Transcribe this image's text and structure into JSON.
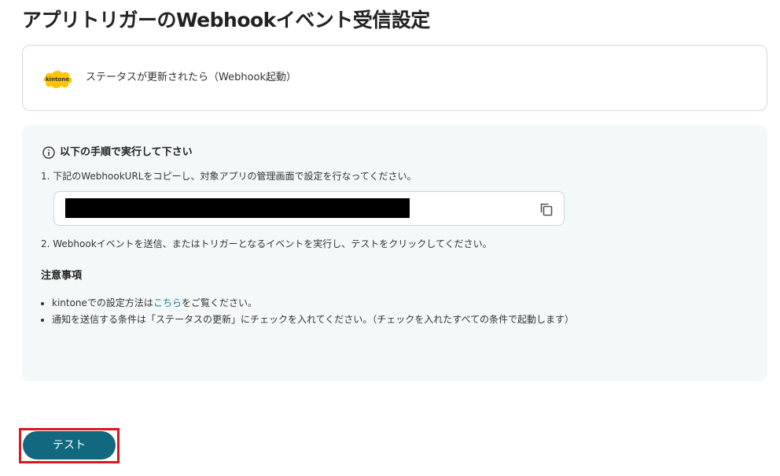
{
  "page": {
    "title": "アプリトリガーのWebhookイベント受信設定"
  },
  "trigger": {
    "app_logo_text": "kintone",
    "app_logo_icon": "kintone-logo-icon",
    "label": "ステータスが更新されたら（Webhook起動）"
  },
  "instructions": {
    "heading": "以下の手順で実行して下さい",
    "heading_icon": "info-icon",
    "step1": "1. 下記のWebhookURLをコピーし、対象アプリの管理画面で設定を行なってください。",
    "step2": "2. Webhookイベントを送信、またはトリガーとなるイベントを実行し、テストをクリックしてください。",
    "copy_icon": "copy-icon"
  },
  "notes": {
    "heading": "注意事項",
    "item1_prefix": "kintoneでの設定方法は",
    "item1_link": "こちら",
    "item1_suffix": "をご覧ください。",
    "item2": "通知を送信する条件は「ステータスの更新」にチェックを入れてください。（チェックを入れたすべての条件で起動します）"
  },
  "actions": {
    "test_label": "テスト"
  },
  "colors": {
    "primary_button": "#12697f",
    "panel_background": "#f3f9f8",
    "link": "#1c6e9c",
    "highlight_border": "#d9181f",
    "kintone_yellow": "#ffc600"
  }
}
